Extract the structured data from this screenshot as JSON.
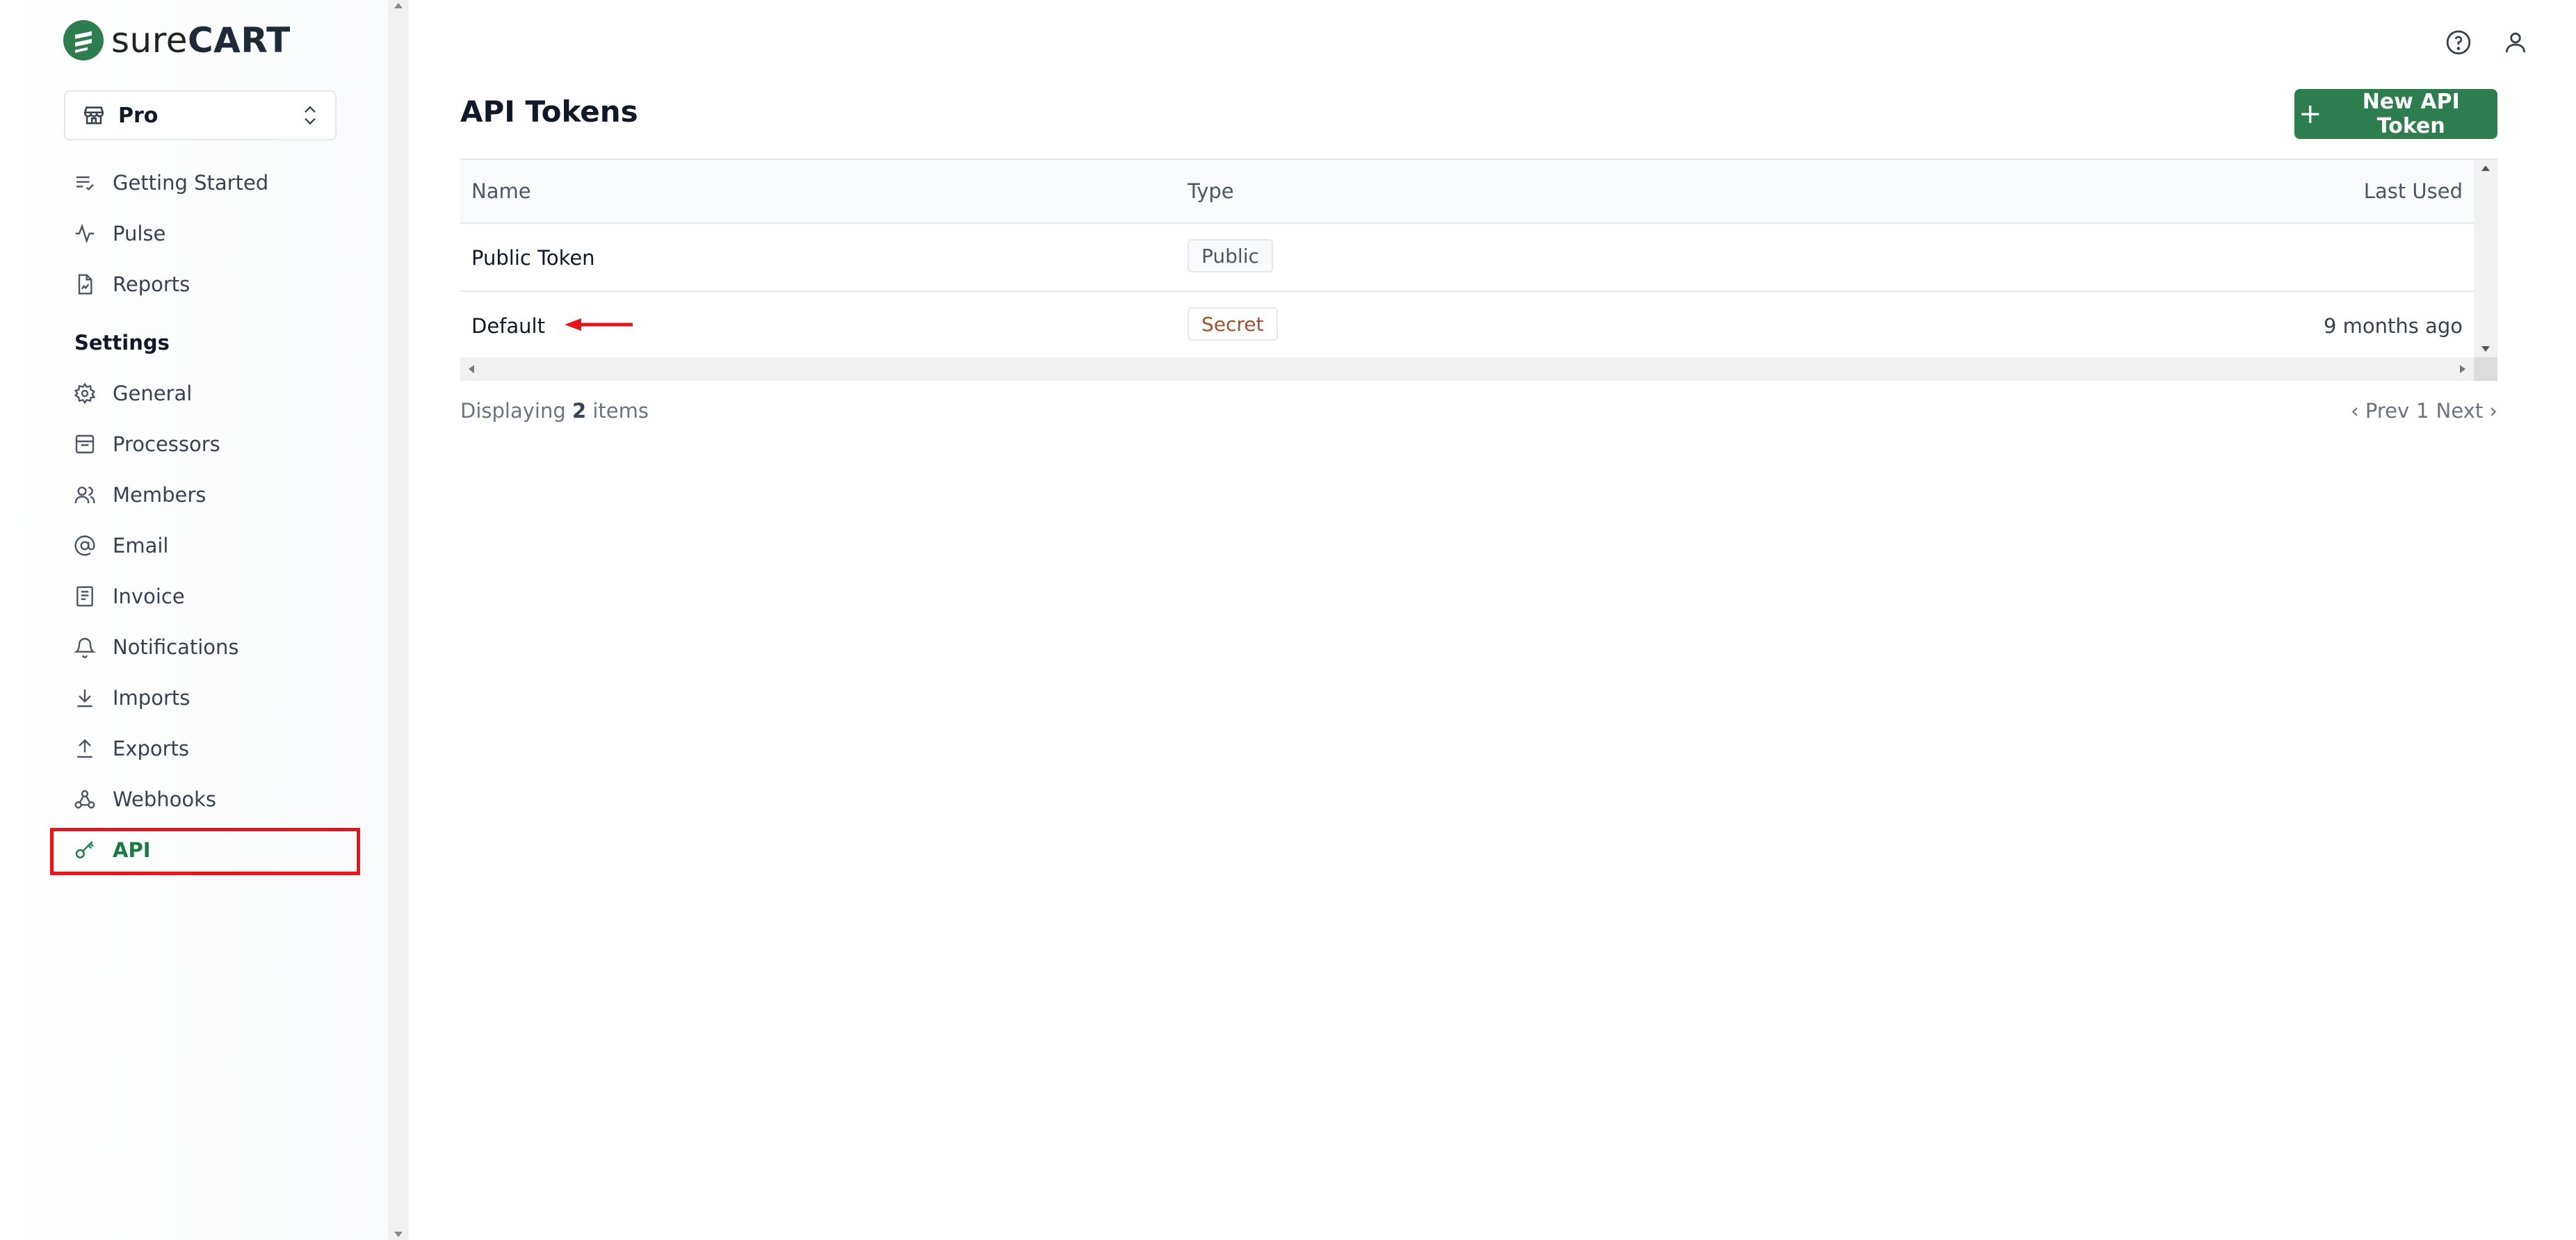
{
  "brand": {
    "name_thin": "sure",
    "name_bold": "CART",
    "accent": "#2e7d4f"
  },
  "store_selector": {
    "value": "Pro"
  },
  "nav": {
    "main": [
      {
        "label": "Getting Started",
        "icon": "list-check-icon"
      },
      {
        "label": "Pulse",
        "icon": "activity-icon"
      },
      {
        "label": "Reports",
        "icon": "report-file-icon"
      }
    ],
    "settings_label": "Settings",
    "settings": [
      {
        "label": "General",
        "icon": "gear-icon"
      },
      {
        "label": "Processors",
        "icon": "inbox-icon"
      },
      {
        "label": "Members",
        "icon": "users-icon"
      },
      {
        "label": "Email",
        "icon": "at-sign-icon"
      },
      {
        "label": "Invoice",
        "icon": "document-icon"
      },
      {
        "label": "Notifications",
        "icon": "bell-icon"
      },
      {
        "label": "Imports",
        "icon": "download-icon"
      },
      {
        "label": "Exports",
        "icon": "upload-icon"
      },
      {
        "label": "Webhooks",
        "icon": "webhook-icon"
      },
      {
        "label": "API",
        "icon": "key-icon",
        "active": true
      }
    ]
  },
  "header": {
    "title": "API Tokens",
    "new_button_label": "New API Token"
  },
  "table": {
    "columns": [
      "Name",
      "Type",
      "Last Used"
    ],
    "rows": [
      {
        "name": "Public Token",
        "type": "Public",
        "last_used": ""
      },
      {
        "name": "Default",
        "type": "Secret",
        "last_used": "9 months ago"
      }
    ]
  },
  "footer": {
    "displaying_prefix": "Displaying",
    "count": "2",
    "displaying_suffix": "items",
    "prev_label": "‹ Prev",
    "page": "1",
    "next_label": "Next ›"
  },
  "colors": {
    "highlight_red": "#e8141a",
    "active_nav": "#1e7a45"
  }
}
